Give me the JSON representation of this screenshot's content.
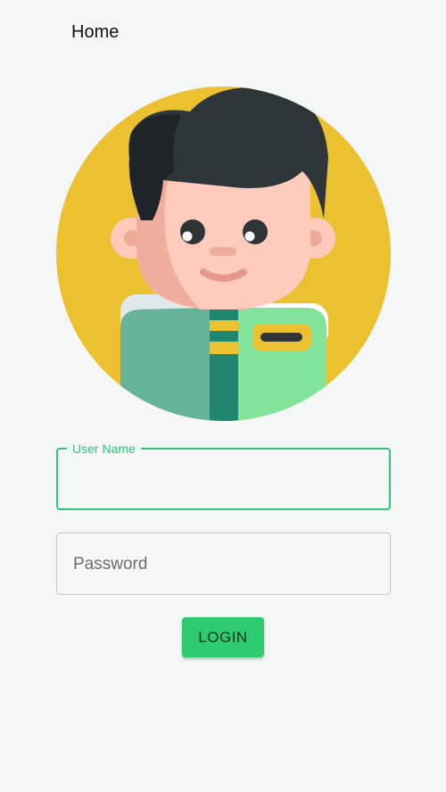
{
  "header": {
    "title": "Home"
  },
  "avatar": {
    "icon": "user-avatar-illustration"
  },
  "form": {
    "username": {
      "label": "User Name",
      "value": ""
    },
    "password": {
      "placeholder": "Password",
      "value": ""
    },
    "login_label": "LOGIN"
  },
  "colors": {
    "accent": "#33c37a",
    "button": "#2ecb70",
    "avatar_bg": "#ecc12f",
    "background": "#f5f7f6"
  }
}
